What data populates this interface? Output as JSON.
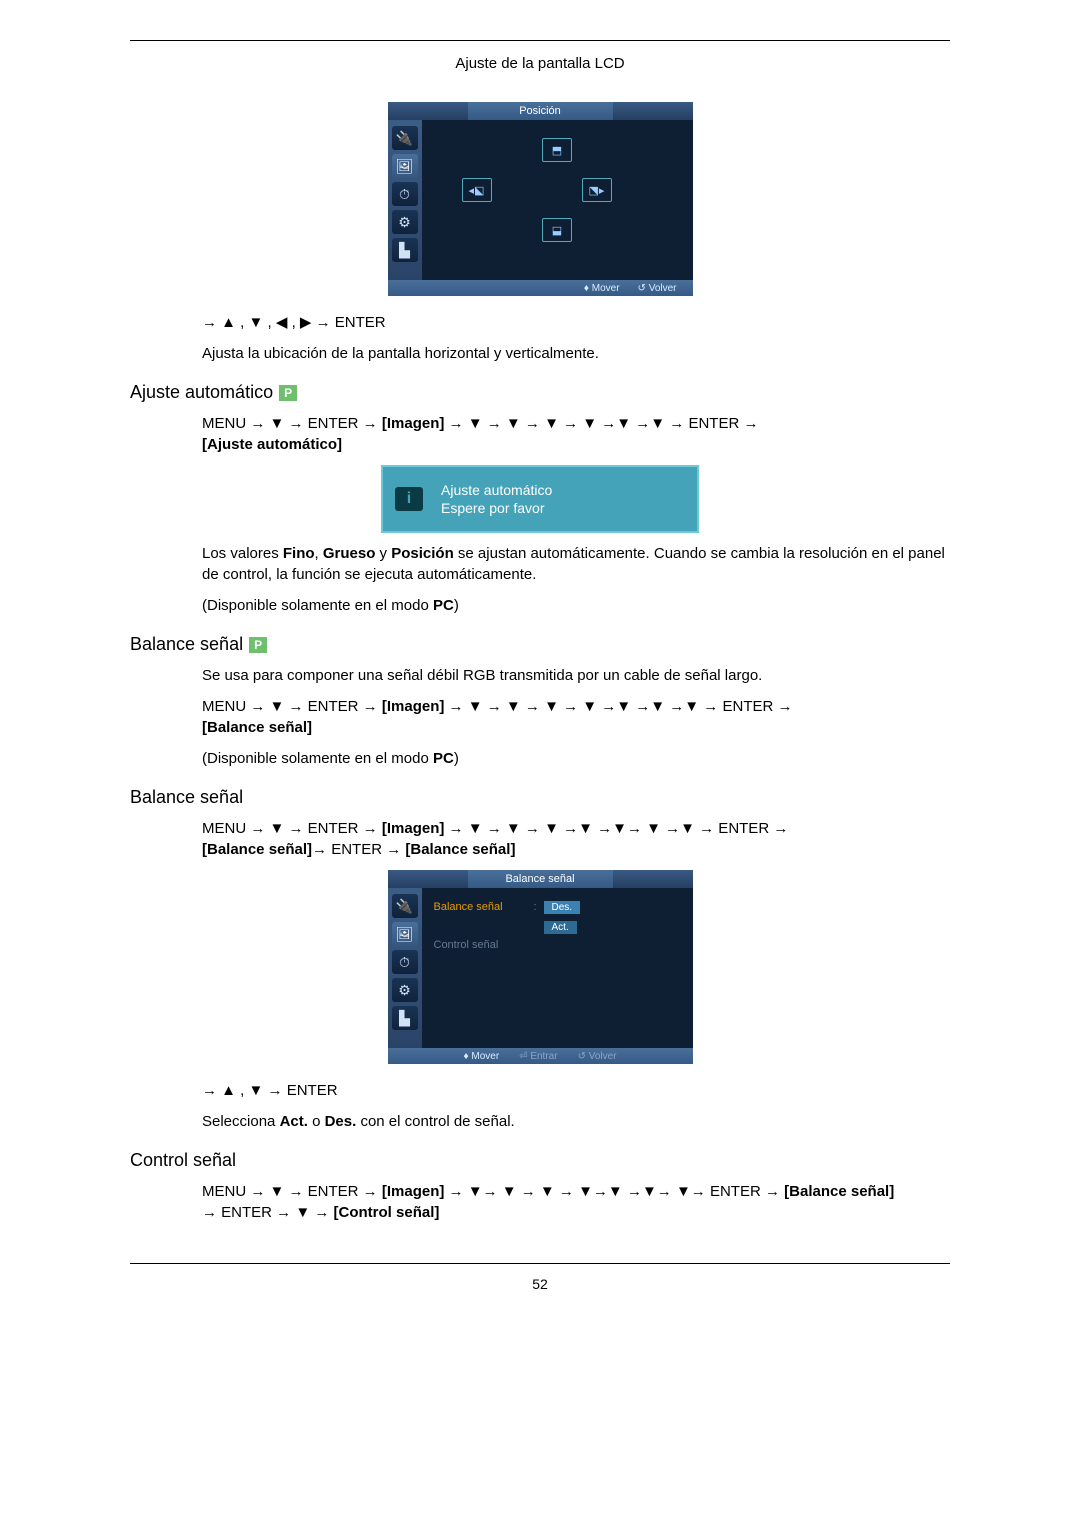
{
  "header": {
    "title": "Ajuste de la pantalla LCD"
  },
  "posicion_osd": {
    "title": "Posición",
    "footer_move": "Mover",
    "footer_back": "Volver"
  },
  "nav1": "→ ▲ , ▼ , ◀ , ▶ → ENTER",
  "posicion_desc": "Ajusta la ubicación de la pantalla horizontal y verticalmente.",
  "sec_auto": {
    "heading": "Ajuste automático"
  },
  "auto_nav_pre": "MENU → ▼ → ENTER → ",
  "auto_nav_imagen": "[Imagen]",
  "auto_nav_mid": " → ▼ → ▼ → ▼ → ▼ →▼ →▼ → ENTER → ",
  "auto_nav_br": "[Ajuste automático]",
  "popup": {
    "line1": "Ajuste automático",
    "line2": "Espere por favor"
  },
  "auto_p1a": "Los valores ",
  "auto_p1b": "Fino",
  "auto_p1c": ", ",
  "auto_p1d": "Grueso",
  "auto_p1e": " y ",
  "auto_p1f": "Posición",
  "auto_p1g": " se ajustan automáticamente. Cuando se cambia la resolución en el panel de control, la función se ejecuta automáticamente.",
  "auto_p2a": "(Disponible solamente en el modo ",
  "auto_p2b": "PC",
  "auto_p2c": ")",
  "sec_bal": {
    "heading": "Balance señal"
  },
  "bal_desc": "Se usa para componer una señal débil RGB transmitida por un cable de señal largo.",
  "bal_nav_pre": "MENU → ▼ → ENTER → ",
  "bal_nav_imagen": "[Imagen]",
  "bal_nav_mid": " → ▼ → ▼ → ▼ → ▼ →▼ →▼ →▼ → ENTER → ",
  "bal_nav_br": "[Balance señal]",
  "bal_p2a": "(Disponible solamente en el modo ",
  "bal_p2b": "PC",
  "bal_p2c": ")",
  "sec_bal2": {
    "heading": "Balance señal"
  },
  "bal2_nav_pre": "MENU → ▼ → ENTER → ",
  "bal2_nav_imagen": "[Imagen]",
  "bal2_nav_mid": " → ▼ → ▼ → ▼ →▼ →▼→ ▼ →▼ → ENTER → ",
  "bal2_nav_br1": "[Balance señal]",
  "bal2_nav_mid2": "→ ENTER → ",
  "bal2_nav_br2": "[Balance señal]",
  "balance_osd": {
    "title": "Balance señal",
    "row1_label": "Balance señal",
    "row2_label": "Control señal",
    "opt_des": "Des.",
    "opt_act": "Act.",
    "footer_move": "Mover",
    "footer_enter": "Entrar",
    "footer_back": "Volver"
  },
  "nav2": "→ ▲ , ▼ → ENTER",
  "bal2_p1a": "Selecciona ",
  "bal2_p1b": "Act.",
  "bal2_p1c": " o ",
  "bal2_p1d": "Des.",
  "bal2_p1e": " con el control de señal.",
  "sec_ctrl": {
    "heading": "Control señal"
  },
  "ctrl_nav_pre": "MENU → ▼ → ENTER → ",
  "ctrl_nav_imagen": "[Imagen]",
  "ctrl_nav_mid": " → ▼→ ▼ → ▼ → ▼→▼ →▼→ ▼→ ENTER → ",
  "ctrl_nav_br1": "[Balance señal]",
  "ctrl_nav_mid2": " → ENTER → ▼ → ",
  "ctrl_nav_br2": "[Control señal]",
  "pagenum": "52"
}
